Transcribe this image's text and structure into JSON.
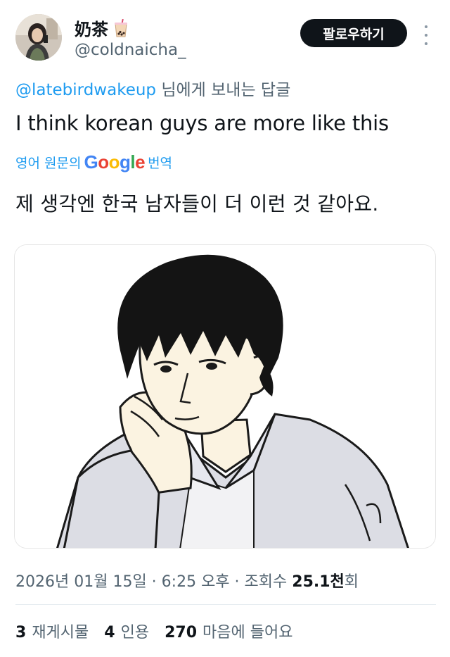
{
  "author": {
    "display_name": "奶茶",
    "handle": "@coldnaicha_",
    "avatar_icon": "profile-photo",
    "name_emoji_icon": "bubble-tea-icon"
  },
  "follow_button": {
    "label": "팔로우하기"
  },
  "more_menu": {
    "icon": "more-vertical-icon"
  },
  "reply": {
    "to_handle": "@latebirdwakeup",
    "suffix": " 님에게 보내는 답글"
  },
  "tweet": {
    "text": "I think korean guys are more like this"
  },
  "translation": {
    "prefix": "영어 원문의",
    "google_letters": [
      "G",
      "o",
      "o",
      "g",
      "l",
      "e"
    ],
    "suffix": "번역",
    "text": "제 생각엔 한국 남자들이 더 이런 것 같아요."
  },
  "media": {
    "icon": "cartoon-man-illustration"
  },
  "meta": {
    "date": "2026년 01월 15일",
    "separator": " · ",
    "time": "6:25 오후",
    "views_label": "조회수 ",
    "views_count": "25.1천",
    "views_suffix": "회"
  },
  "stats": {
    "retweets_count": "3",
    "retweets_label": "재게시물",
    "quotes_count": "4",
    "quotes_label": "인용",
    "likes_count": "270",
    "likes_label": "마음에 들어요"
  },
  "colors": {
    "link": "#1d9bf0",
    "secondary_text": "#536471",
    "primary_text": "#0f1419",
    "button_bg": "#0f1419"
  }
}
